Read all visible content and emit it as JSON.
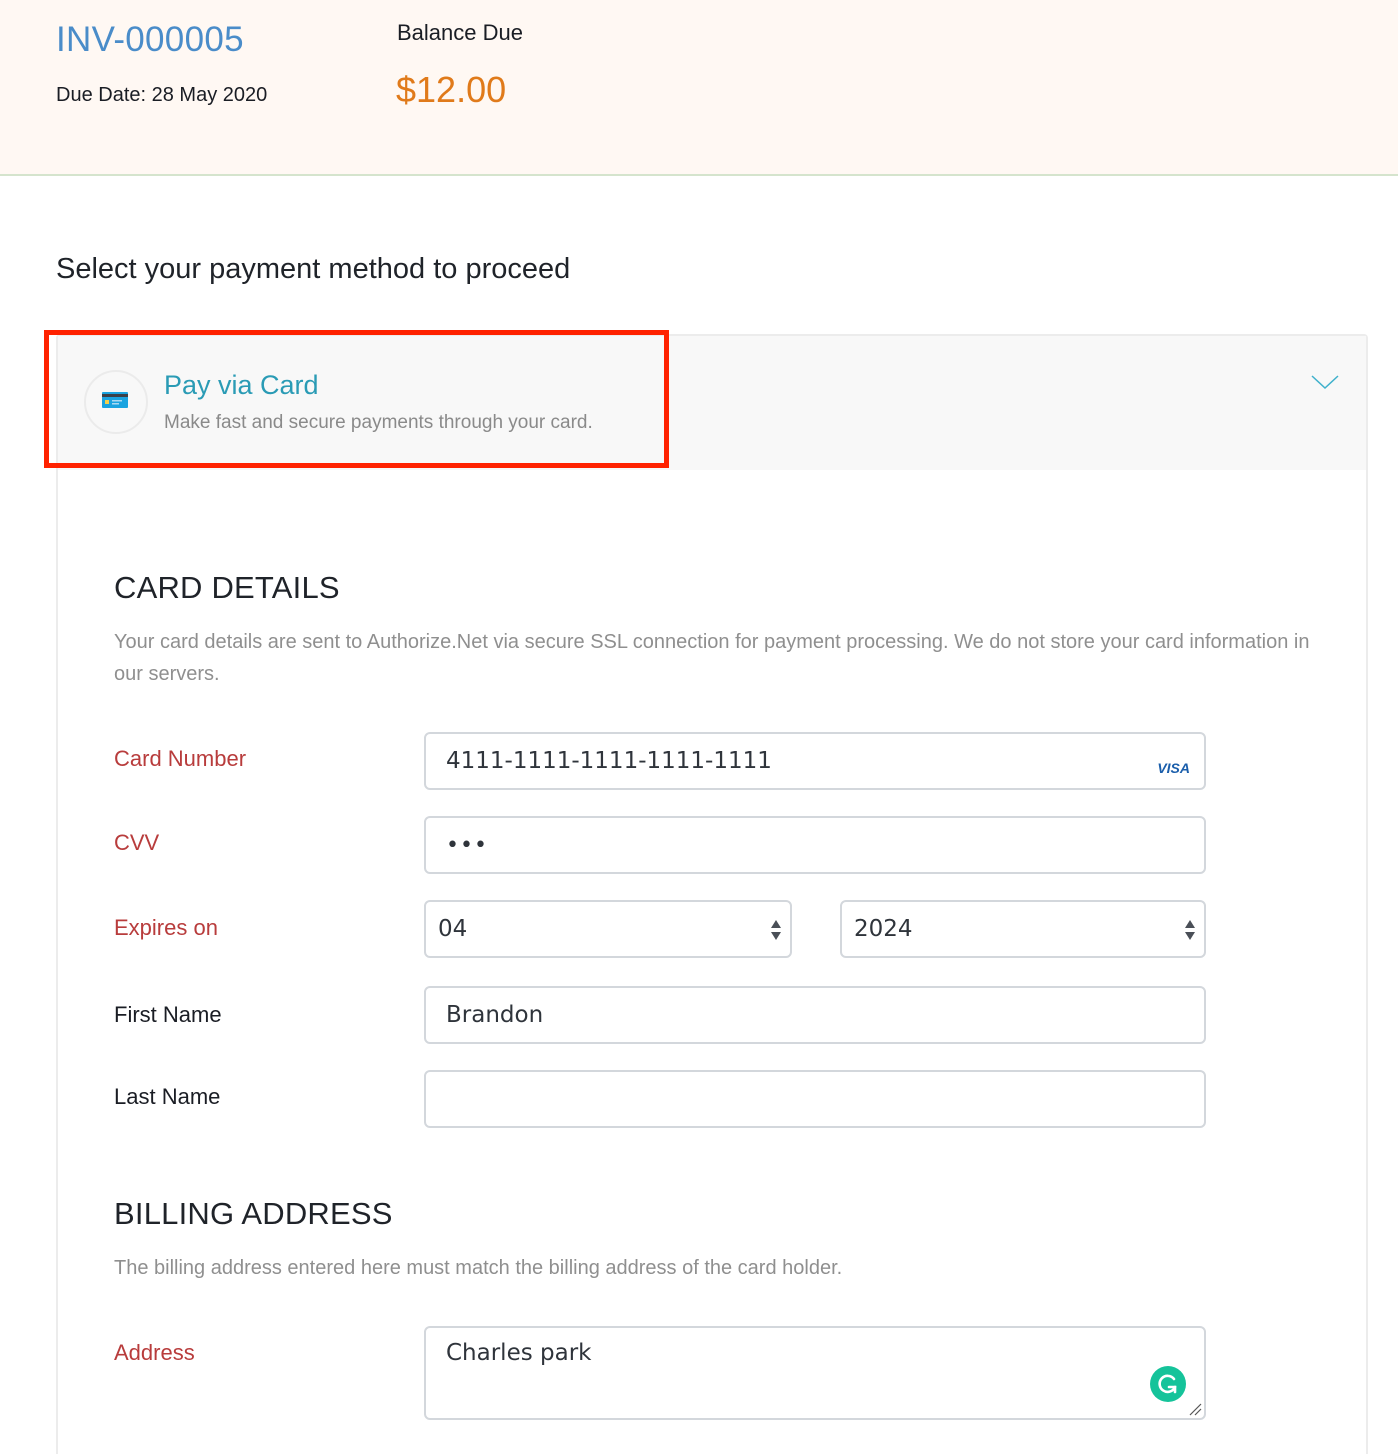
{
  "invoice": {
    "number": "INV-000005",
    "due_date": "Due Date: 28 May 2020",
    "balance_label": "Balance Due",
    "balance_amount": "$12.00"
  },
  "payment": {
    "prompt": "Select your payment method to proceed",
    "method": {
      "icon": "credit-card-icon",
      "title": "Pay via Card",
      "description": "Make fast and secure payments through your card.",
      "expanded_icon": "chevron-down-icon"
    }
  },
  "card_details": {
    "heading": "CARD DETAILS",
    "help": "Your card details are sent to Authorize.Net via secure SSL connection for payment processing. We do not store your card information in our servers.",
    "fields": {
      "card_number": {
        "label": "Card Number",
        "value": "4111-1111-1111-1111-1111",
        "brand": "VISA",
        "required": true
      },
      "cvv": {
        "label": "CVV",
        "value": "•••",
        "required": true
      },
      "expires": {
        "label": "Expires on",
        "month": "04",
        "year": "2024",
        "required": true
      },
      "first_name": {
        "label": "First Name",
        "value": "Brandon",
        "required": false
      },
      "last_name": {
        "label": "Last Name",
        "value": "",
        "required": false
      }
    }
  },
  "billing_address": {
    "heading": "BILLING ADDRESS",
    "help": "The billing address entered here must match the billing address of the card holder.",
    "fields": {
      "address": {
        "label": "Address",
        "value": "Charles park",
        "required": true
      }
    }
  },
  "colors": {
    "invoice_number": "#4a8cc9",
    "balance_amount": "#e07a1a",
    "method_title": "#2a9bb5",
    "required_label": "#b83c3c",
    "highlight_box": "#ff2200",
    "grammarly": "#15c39a"
  }
}
